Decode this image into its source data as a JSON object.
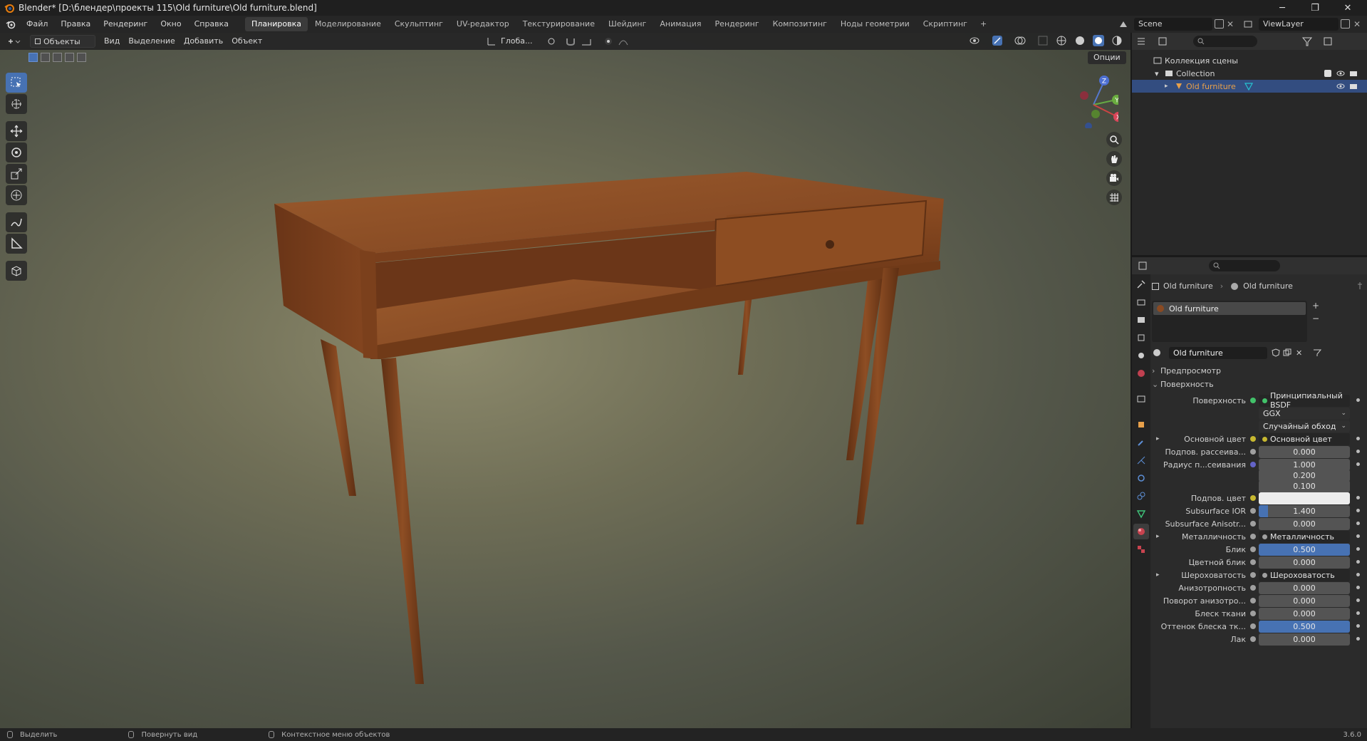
{
  "window": {
    "title": "Blender* [D:\\блендер\\проекты 115\\Old furniture\\Old furniture.blend]",
    "min": "─",
    "max": "❐",
    "close": "✕"
  },
  "menu": [
    "Файл",
    "Правка",
    "Рендеринг",
    "Окно",
    "Справка"
  ],
  "workspaces": [
    "Планировка",
    "Моделирование",
    "Скульптинг",
    "UV-редактор",
    "Текстурирование",
    "Шейдинг",
    "Анимация",
    "Рендеринг",
    "Композитинг",
    "Ноды геометрии",
    "Скриптинг"
  ],
  "workspace_add": "+",
  "scene_name": "Scene",
  "view_layer": "ViewLayer",
  "viewport": {
    "mode": "Объекты",
    "menus": [
      "Вид",
      "Выделение",
      "Добавить",
      "Объект"
    ],
    "transform_orientation": "Глоба...",
    "options": "Опции",
    "gizmo": {
      "x": "X",
      "y": "Y",
      "z": "Z"
    }
  },
  "outliner": {
    "scene_collection": "Коллекция сцены",
    "collection": "Collection",
    "object": "Old furniture"
  },
  "properties": {
    "breadcrumb_object": "Old furniture",
    "breadcrumb_material": "Old furniture",
    "material_slot": "Old furniture",
    "material_name": "Old furniture",
    "panel_preview": "Предпросмотр",
    "panel_surface": "Поверхность",
    "rows": [
      {
        "label": "Поверхность",
        "value": "Принципиальный BSDF",
        "kind": "link",
        "dot": "green"
      },
      {
        "label": "",
        "value": "GGX",
        "kind": "dropdown"
      },
      {
        "label": "",
        "value": "Случайный обход",
        "kind": "dropdown"
      },
      {
        "label": "Основной цвет",
        "value": "Основной цвет",
        "kind": "link",
        "dot": "yellow",
        "expander": "▸"
      },
      {
        "label": "Подпов. рассеива...",
        "value": "0.000",
        "kind": "num",
        "dot": "grey"
      },
      {
        "label": "Радиус п...сеивания",
        "value": "1.000",
        "kind": "num",
        "dot": "blue"
      },
      {
        "label": "",
        "value": "0.200",
        "kind": "num"
      },
      {
        "label": "",
        "value": "0.100",
        "kind": "num"
      },
      {
        "label": "Подпов. цвет",
        "value": "",
        "kind": "color",
        "dot": "yellow"
      },
      {
        "label": "Subsurface IOR",
        "value": "1.400",
        "kind": "num",
        "dot": "grey",
        "fill": 0.1
      },
      {
        "label": "Subsurface Anisotr...",
        "value": "0.000",
        "kind": "num",
        "dot": "grey"
      },
      {
        "label": "Металличность",
        "value": "Металличность",
        "kind": "link",
        "dot": "grey",
        "expander": "▸"
      },
      {
        "label": "Блик",
        "value": "0.500",
        "kind": "num",
        "dot": "grey",
        "fill": 1.0
      },
      {
        "label": "Цветной блик",
        "value": "0.000",
        "kind": "num",
        "dot": "grey"
      },
      {
        "label": "Шероховатость",
        "value": "Шероховатость",
        "kind": "link",
        "dot": "grey",
        "expander": "▸"
      },
      {
        "label": "Анизотропность",
        "value": "0.000",
        "kind": "num",
        "dot": "grey"
      },
      {
        "label": "Поворот анизотро...",
        "value": "0.000",
        "kind": "num",
        "dot": "grey"
      },
      {
        "label": "Блеск ткани",
        "value": "0.000",
        "kind": "num",
        "dot": "grey"
      },
      {
        "label": "Оттенок блеска тк...",
        "value": "0.500",
        "kind": "num",
        "dot": "grey",
        "fill": 1.0
      },
      {
        "label": "Лак",
        "value": "0.000",
        "kind": "num",
        "dot": "grey"
      }
    ]
  },
  "status": {
    "select": "Выделить",
    "rotate": "Повернуть вид",
    "context": "Контекстное меню объектов",
    "version": "3.6.0"
  },
  "colors": {
    "accent": "#4772b3",
    "selection": "#334d80",
    "wood": "#8a4a22"
  }
}
